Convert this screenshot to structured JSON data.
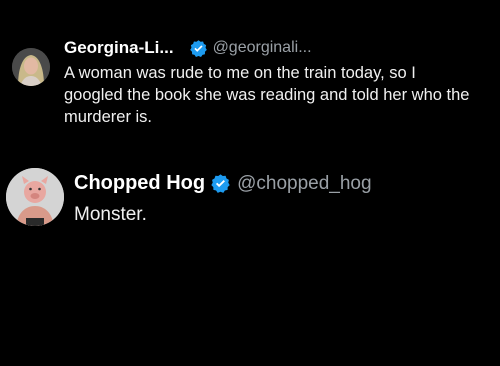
{
  "tweets": [
    {
      "display_name": "Georgina-Li...",
      "handle": "@georginali...",
      "verified": true,
      "text": "A woman was rude to me on the train today, so I googled the book she was reading and told her who the murderer is."
    },
    {
      "display_name": "Chopped Hog",
      "handle": "@chopped_hog",
      "verified": true,
      "text": "Monster."
    }
  ],
  "icons": {
    "verified_badge": "verified-badge-icon",
    "avatar_1": "profile-photo-woman",
    "avatar_2": "profile-photo-pig-mask"
  },
  "colors": {
    "background": "#000000",
    "text": "#e7e9ea",
    "handle": "#9aa0a6",
    "verified_blue": "#1d9bf0"
  }
}
